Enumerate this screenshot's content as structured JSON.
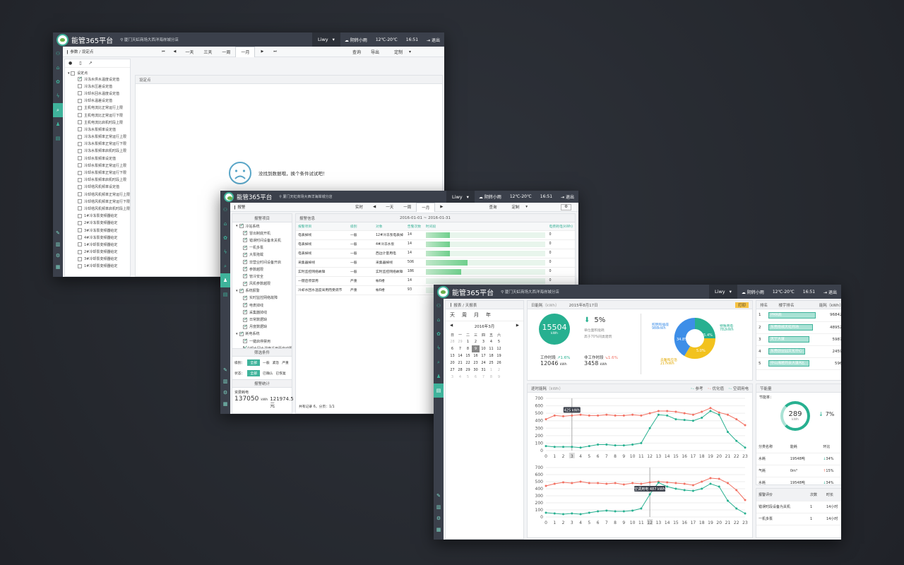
{
  "app": {
    "title": "能管365平台",
    "location": "厦门天虹商场大西洋海岸城分店",
    "user": "Liwy",
    "weather": "阴转小雨",
    "temperature": "12℃-20℃",
    "time": "16:51",
    "logout": "退出"
  },
  "colors": {
    "accent": "#3fb39b",
    "dark": "#3b404b",
    "red": "#f27264"
  },
  "w1": {
    "breadcrumb": "参数 / 设定点",
    "toolbar": [
      "一天",
      "三天",
      "一周",
      "一月"
    ],
    "actions": [
      "查询",
      "导出",
      "定制"
    ],
    "panel_title": "设定点",
    "tree_root": "设定点",
    "tree": [
      "冷冻水供水温度设定值",
      "冷冻水压差设定值",
      "冷却水回水温度设定值",
      "冷却水温差设定值",
      "主机电流比正常运行上限",
      "主机电流比正常运行下限",
      "主机电流比启机时段上限",
      "冷冻水泵频率设定值",
      "冷冻水泵频率正常运行上限",
      "冷冻水泵频率正常运行下限",
      "冷冻水泵频率启机时段上限",
      "冷却水泵频率设定值",
      "冷却水泵频率正常运行上限",
      "冷却水泵频率正常运行下限",
      "冷却水泵频率启机时段上限",
      "冷却塔风机频率设定值",
      "冷却塔风机频率正常运行上限",
      "冷却塔风机频率正常运行下限",
      "冷却塔风机频率启机时段上限",
      "1#冷冻泵变频器给定",
      "2#冷冻泵变频器给定",
      "3#冷冻泵变频器给定",
      "4#冷冻泵变频器给定",
      "1#冷却泵变频器给定",
      "2#冷却泵变频器给定",
      "3#冷却泵变频器给定",
      "1#冷却泵变频器给定"
    ],
    "empty": "没找到数据哦，换个条件试试吧！"
  },
  "w2": {
    "breadcrumb": "报警",
    "toolbar": [
      "实时",
      "一天",
      "一周",
      "一月"
    ],
    "actions": [
      "查询",
      "定制"
    ],
    "tree_title": "报警项目",
    "tree": [
      {
        "t": "冷站系统",
        "lv": 1
      },
      {
        "t": "冒出制底开机",
        "lv": 2
      },
      {
        "t": "错误时间设备未关机",
        "lv": 2
      },
      {
        "t": "一机多泵",
        "lv": 2
      },
      {
        "t": "大泵拖载",
        "lv": 2
      },
      {
        "t": "非营业时间设备开启",
        "lv": 2
      },
      {
        "t": "参数越限",
        "lv": 2
      },
      {
        "t": "管冷安全",
        "lv": 2
      },
      {
        "t": "风机参数越限",
        "lv": 2
      },
      {
        "t": "系统报警",
        "lv": 1
      },
      {
        "t": "实时监控网络故障",
        "lv": 2
      },
      {
        "t": "电表掉线",
        "lv": 2
      },
      {
        "t": "采集器掉线",
        "lv": 2
      },
      {
        "t": "日常数据缺",
        "lv": 2
      },
      {
        "t": "月度数据缺",
        "lv": 2
      },
      {
        "t": "耗电系统",
        "lv": 1
      },
      {
        "t": "一键启停禁用",
        "lv": 2
      },
      {
        "t": "冷却水回水温度采用而自动跟踪",
        "lv": 2
      },
      {
        "t": "冷冻水供水温度设定值偏大与...",
        "lv": 2
      }
    ],
    "filter_title": "筛选条件",
    "filter_level_label": "级别：",
    "filter_levels": [
      "全部",
      "一般",
      "紧急",
      "严重"
    ],
    "filter_state_label": "状态：",
    "filter_states": [
      "全部",
      "已确认",
      "已恢复"
    ],
    "stats_title": "报警统计",
    "stats_label": "资费耗电",
    "stats_value1": "137050",
    "stats_unit": "kWh",
    "stats_value2": "121974.5元",
    "info_title": "报警信息",
    "info_range": "2016-01-01 ~ 2016-01-31",
    "columns": [
      "报警项目",
      "级别",
      "对象",
      "告警次数",
      "时间段",
      "电费耗电(kWh)"
    ],
    "rows": [
      {
        "item": "电表掉线",
        "level": "一般",
        "obj": "12#冷冻泵电表掉",
        "count": "14",
        "bar": 0.2,
        "kwh": "0"
      },
      {
        "item": "电表掉线",
        "level": "一般",
        "obj": "4#冷冻水泵",
        "count": "14",
        "bar": 0.2,
        "kwh": "0"
      },
      {
        "item": "电表掉线",
        "level": "一般",
        "obj": "西边计量用电",
        "count": "14",
        "bar": 0.2,
        "kwh": "0"
      },
      {
        "item": "采集器掉线",
        "level": "一般",
        "obj": "采集器掉线",
        "count": "506",
        "bar": 0.35,
        "kwh": "0"
      },
      {
        "item": "实时监控网络故障",
        "level": "一般",
        "obj": "实时监控网络故障",
        "count": "186",
        "bar": 0.3,
        "kwh": "0"
      },
      {
        "item": "一键启停禁用",
        "level": "严重",
        "obj": "帐6楼",
        "count": "14",
        "bar": 0.0,
        "kwh": "0"
      },
      {
        "item": "冷却水回水温度采用而受调节",
        "level": "严重",
        "obj": "帐6楼",
        "count": "93",
        "bar": 0.0,
        "kwh": "0"
      }
    ],
    "footer": "共有记录 6，分页：1/1"
  },
  "w3": {
    "breadcrumb": "报表 / 天报表",
    "range_tabs": [
      "天",
      "周",
      "月",
      "年"
    ],
    "cal_month": "2016年3月",
    "weekdays": [
      "日",
      "一",
      "二",
      "三",
      "四",
      "五",
      "六"
    ],
    "days": [
      "28",
      "29",
      "1",
      "2",
      "3",
      "4",
      "5",
      "6",
      "7",
      "8",
      "9",
      "10",
      "11",
      "12",
      "13",
      "14",
      "15",
      "16",
      "17",
      "18",
      "19",
      "20",
      "21",
      "22",
      "23",
      "24",
      "25",
      "26",
      "27",
      "28",
      "29",
      "30",
      "31",
      "1",
      "2",
      "3",
      "4",
      "5",
      "6",
      "7",
      "8",
      "9"
    ],
    "day_title": "日能耗",
    "day_unit": "（kWh）",
    "day_date": "2015年8月17日",
    "print": "打印",
    "total": "15504",
    "total_unit": "kWh",
    "change": "5%",
    "change_desc1": "单位面积能耗",
    "change_desc2": "高于70%同类建筑",
    "work_label": "工作时段",
    "work_pct": "1.6%",
    "work_val": "12046",
    "unit": "kWh",
    "nonwork_label": "非工作时段",
    "nonwork_pct": "1.6%",
    "nonwork_val": "3458",
    "pie_labels": [
      {
        "name": "照明和插座",
        "val": "988kWh"
      },
      {
        "name": "特殊用电",
        "val": "782kWh"
      },
      {
        "name": "去暖和应急",
        "val": "217kWh"
      }
    ],
    "pie_pcts": [
      "34.8%",
      "25.4%",
      "5.0%"
    ],
    "rank_headers": [
      "排名",
      "楼宇排名",
      "能耗（kWh）"
    ],
    "ranks": [
      {
        "n": "1",
        "name": "PMR商",
        "v": "968421",
        "f": 0.9
      },
      {
        "n": "2",
        "name": "东莞南城天虹商场",
        "v": "489521",
        "f": 0.85
      },
      {
        "n": "3",
        "name": "天宁大厦",
        "v": "59872",
        "f": 0.78
      },
      {
        "n": "4",
        "name": "东莞创业园文化中心",
        "v": "24591",
        "f": 0.7
      },
      {
        "n": "5",
        "name": "中山海雅商会大厦A区",
        "v": "5968",
        "f": 0.78
      }
    ],
    "saving_title": "节能量",
    "saving_rate_label": "节能率：",
    "saving_value": "289",
    "saving_unit": "kWh",
    "saving_pct": "7%",
    "cat_headers": [
      "分类名称",
      "能耗",
      "环比"
    ],
    "cats": [
      {
        "name": "水耗",
        "v": "19548吨",
        "r": "34%",
        "dir": "down"
      },
      {
        "name": "气耗",
        "v": "0m³",
        "r": "15%",
        "dir": "up"
      },
      {
        "name": "水耗",
        "v": "19548吨",
        "r": "34%",
        "dir": "down"
      }
    ],
    "eval_headers": [
      "报警评价",
      "次数",
      "时长"
    ],
    "evals": [
      {
        "name": "错误时段设备为关机",
        "n": "1",
        "t": "14小时"
      },
      {
        "name": "一机多泵",
        "n": "1",
        "t": "14小时"
      }
    ],
    "realtime_title": "逐时能耗",
    "realtime_unit": "（kWh）",
    "legend": [
      "参考",
      "优化值",
      "空调用电"
    ],
    "tooltip1": "425 kWh",
    "tooltip2": "空调用电 487 kWh"
  },
  "chart_data": [
    {
      "type": "line",
      "title": "逐时能耗",
      "x": [
        0,
        1,
        2,
        3,
        4,
        5,
        6,
        7,
        8,
        9,
        10,
        11,
        12,
        13,
        14,
        15,
        16,
        17,
        18,
        19,
        20,
        21,
        22,
        23
      ],
      "ylim": [
        0,
        700
      ],
      "yticks": [
        0,
        100,
        200,
        300,
        400,
        500,
        600,
        700
      ],
      "series": [
        {
          "name": "优化值",
          "values": [
            420,
            470,
            460,
            470,
            480,
            470,
            470,
            480,
            470,
            470,
            480,
            470,
            500,
            530,
            530,
            520,
            500,
            480,
            520,
            570,
            510,
            480,
            420,
            340
          ]
        },
        {
          "name": "空调用电",
          "values": [
            60,
            50,
            50,
            50,
            40,
            60,
            80,
            80,
            70,
            70,
            80,
            100,
            300,
            480,
            470,
            420,
            410,
            400,
            440,
            530,
            480,
            250,
            130,
            40
          ]
        }
      ]
    },
    {
      "type": "line",
      "title": "",
      "x": [
        0,
        1,
        2,
        3,
        4,
        5,
        6,
        7,
        8,
        9,
        10,
        11,
        12,
        13,
        14,
        15,
        16,
        17,
        18,
        19,
        20,
        21,
        22,
        23
      ],
      "ylim": [
        0,
        700
      ],
      "yticks": [
        0,
        100,
        200,
        300,
        400,
        500,
        600,
        700
      ],
      "series": [
        {
          "name": "优化值",
          "values": [
            440,
            470,
            490,
            480,
            500,
            480,
            480,
            470,
            480,
            460,
            480,
            470,
            490,
            500,
            490,
            480,
            470,
            450,
            500,
            550,
            540,
            480,
            380,
            240
          ]
        },
        {
          "name": "空调用电",
          "values": [
            60,
            50,
            40,
            50,
            40,
            60,
            80,
            90,
            80,
            80,
            90,
            120,
            320,
            487,
            430,
            400,
            380,
            370,
            400,
            470,
            430,
            230,
            120,
            50
          ]
        }
      ]
    }
  ]
}
